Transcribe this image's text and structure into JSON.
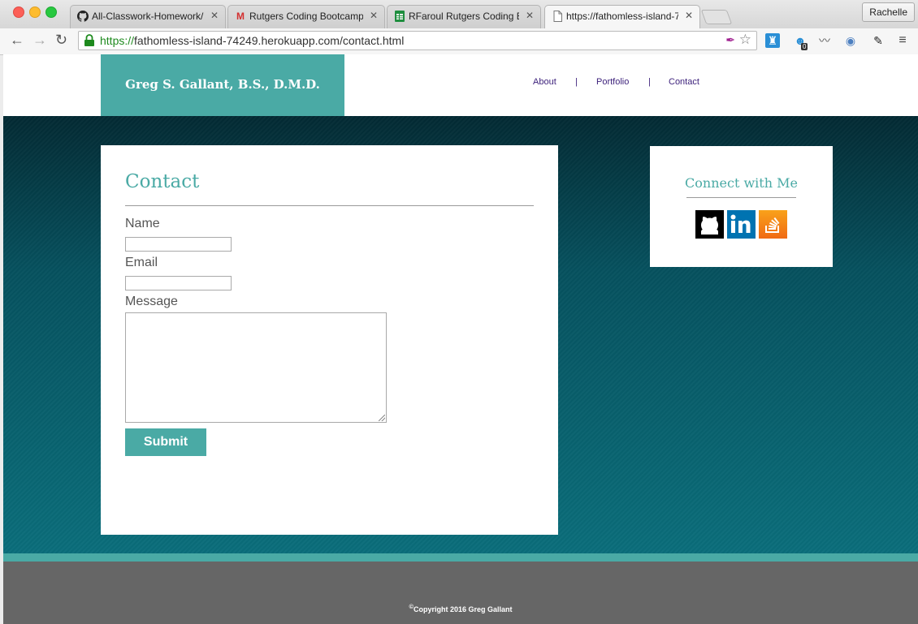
{
  "browser": {
    "tabs": [
      {
        "title": "All-Classwork-Homework/",
        "icon": "github-icon"
      },
      {
        "title": "Rutgers Coding Bootcamp",
        "icon": "gmail-icon"
      },
      {
        "title": "RFaroul Rutgers Coding Bo",
        "icon": "sheets-icon"
      },
      {
        "title": "https://fathomless-island-7",
        "icon": "page-icon"
      }
    ],
    "profile": "Rachelle",
    "url_scheme": "https://",
    "url_rest": "fathomless-island-74249.herokuapp.com/contact.html",
    "ext_badge": "0"
  },
  "site": {
    "brand": "Greg S. Gallant, B.S., D.M.D.",
    "nav": {
      "about": "About",
      "portfolio": "Portfolio",
      "contact": "Contact",
      "separator": "|"
    }
  },
  "contact": {
    "title": "Contact",
    "name_label": "Name",
    "email_label": "Email",
    "message_label": "Message",
    "submit_label": "Submit"
  },
  "social": {
    "title": "Connect with Me",
    "icons": [
      "github-icon",
      "linkedin-icon",
      "stackoverflow-icon"
    ]
  },
  "footer": {
    "copyright_symbol": "©",
    "copyright": "Copyright 2016 Greg Gallant"
  },
  "colors": {
    "accent": "#4aaaa5",
    "footer": "#666666",
    "hero_top": "#032a33",
    "hero_bottom": "#0a6e7b"
  }
}
